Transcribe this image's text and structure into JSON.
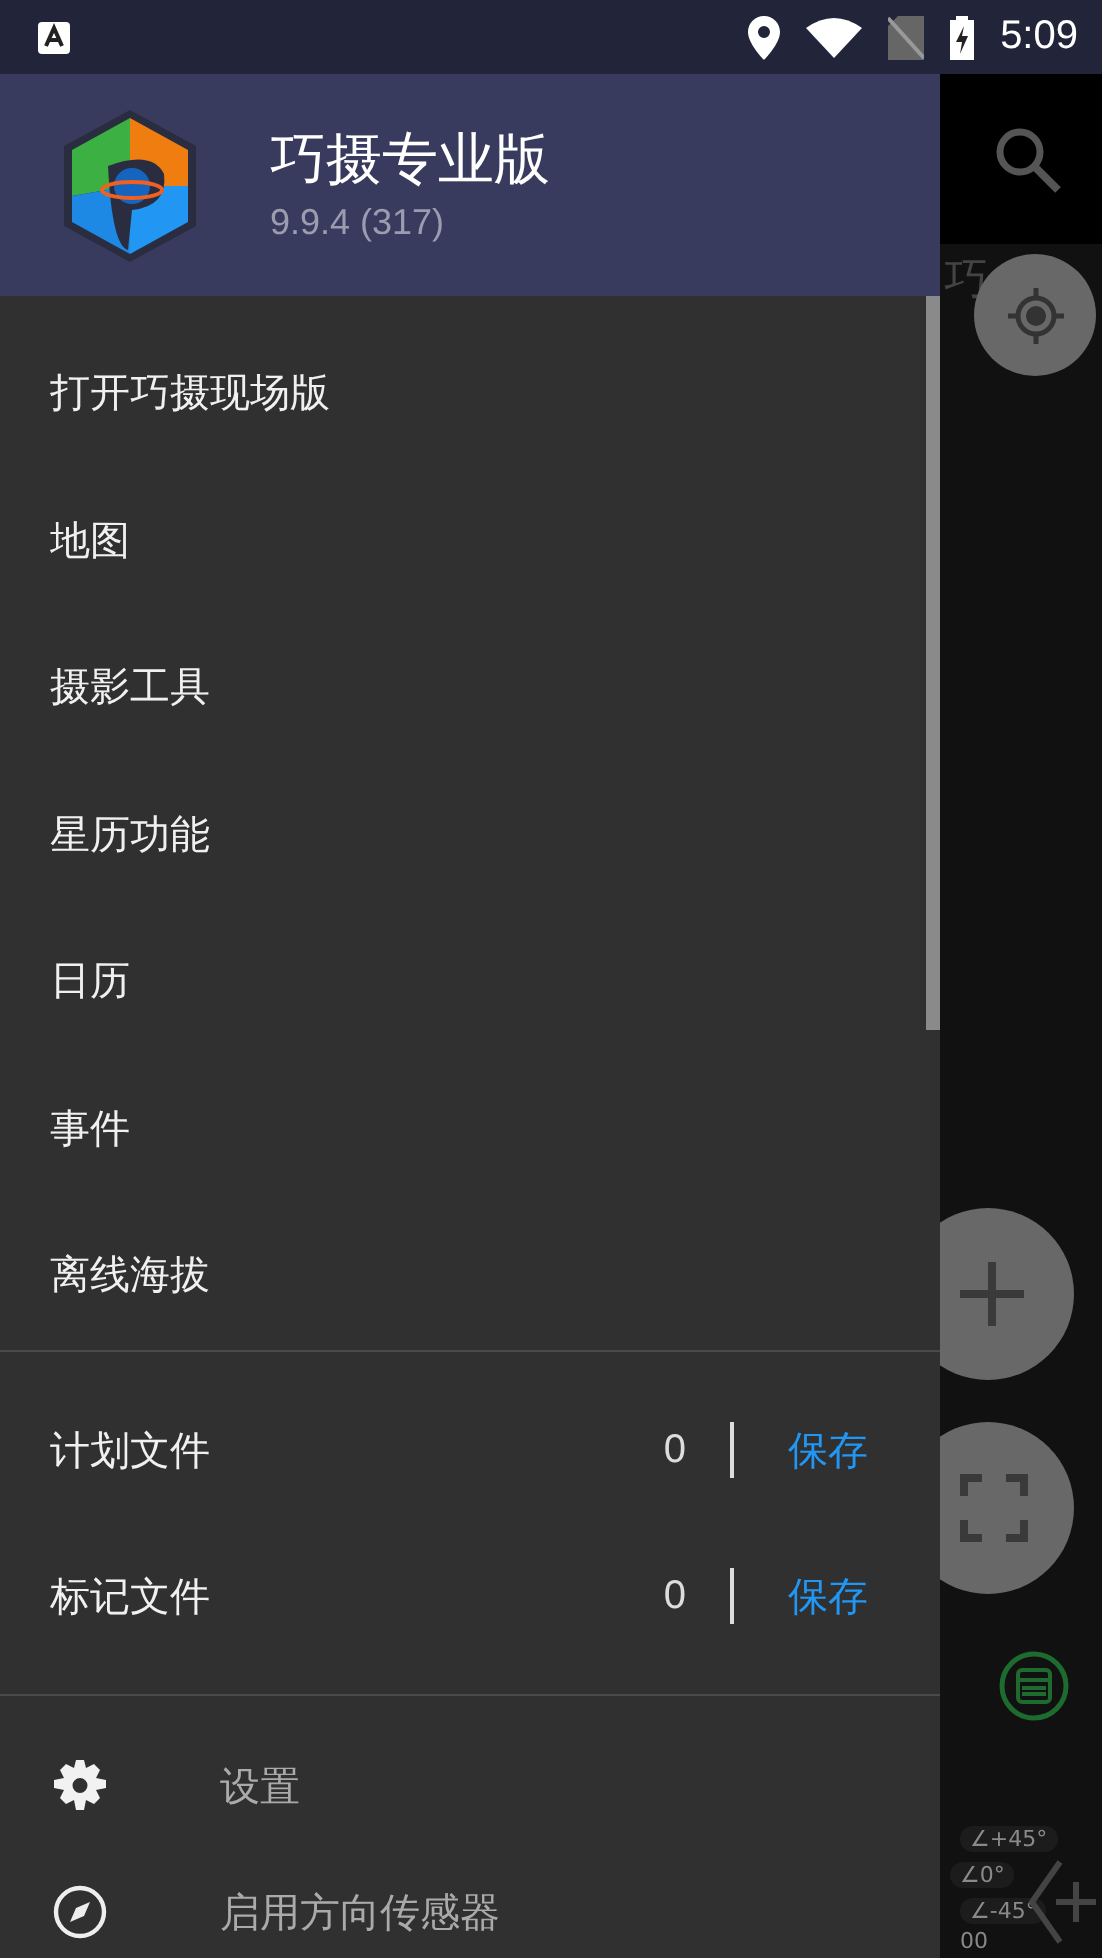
{
  "status_bar": {
    "time": "5:09"
  },
  "drawer": {
    "header": {
      "title": "巧摄专业版",
      "version": "9.9.4 (317)"
    },
    "menu": [
      {
        "label": "打开巧摄现场版"
      },
      {
        "label": "地图"
      },
      {
        "label": "摄影工具"
      },
      {
        "label": "星历功能"
      },
      {
        "label": "日历"
      },
      {
        "label": "事件"
      },
      {
        "label": "离线海拔"
      }
    ],
    "files": [
      {
        "label": "计划文件",
        "count": "0",
        "action": "保存"
      },
      {
        "label": "标记文件",
        "count": "0",
        "action": "保存"
      }
    ],
    "settings": [
      {
        "kind": "gear",
        "label": "设置"
      },
      {
        "kind": "compass",
        "label": "启用方向传感器"
      }
    ]
  },
  "background": {
    "cut_title": "巧",
    "angle_labels": [
      "∠+45°",
      "∠0°",
      "∠-45°"
    ],
    "corner_label": "00"
  }
}
